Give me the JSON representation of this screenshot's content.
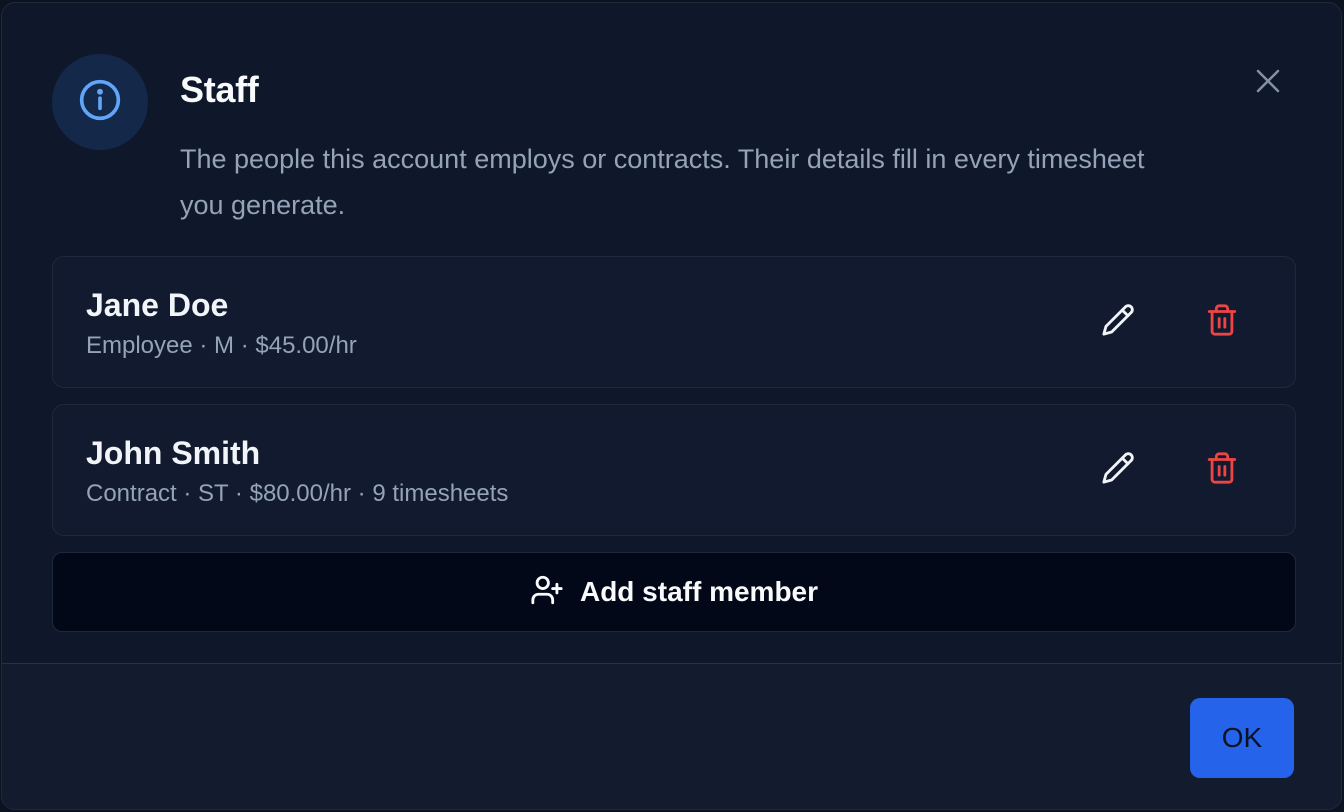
{
  "dialog": {
    "title": "Staff",
    "description": "The people this account employs or contracts. Their details fill in every timesheet you generate.",
    "icons": {
      "header": "info-icon",
      "close": "close-icon"
    }
  },
  "staff": [
    {
      "name": "Jane Doe",
      "meta": "Employee · M · $45.00/hr"
    },
    {
      "name": "John Smith",
      "meta": "Contract · ST · $80.00/hr · 9 timesheets"
    }
  ],
  "row_icons": {
    "edit": "pencil-icon",
    "delete": "trash-icon"
  },
  "add_button": {
    "label": "Add staff member",
    "icon": "user-plus-icon"
  },
  "footer": {
    "ok_label": "OK"
  },
  "colors": {
    "accent": "#2563eb",
    "danger": "#ef4444",
    "info": "#60a5fa"
  }
}
